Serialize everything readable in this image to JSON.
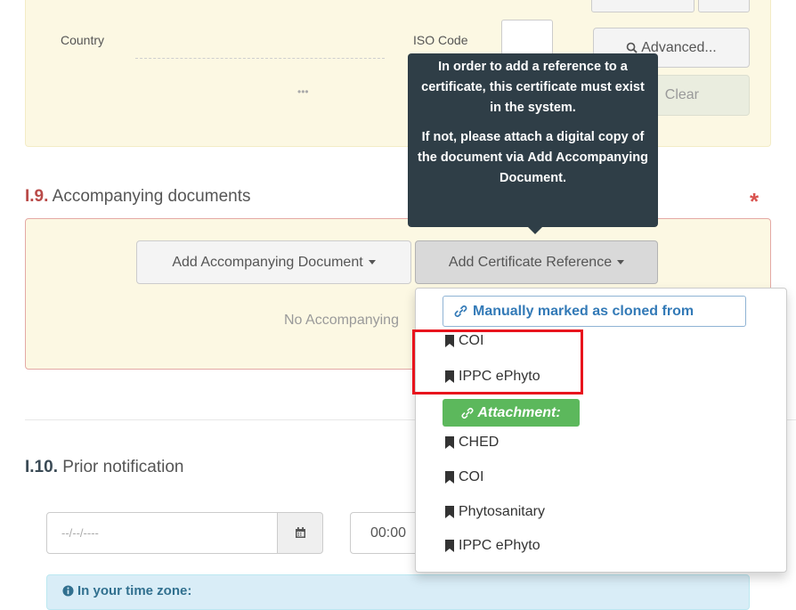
{
  "top_panel": {
    "country_label": "Country",
    "country_value": "•••",
    "iso_label": "ISO Code",
    "advanced_button": "Advanced...",
    "clear_button": "Clear"
  },
  "tooltip": {
    "paragraph1": "In order to add a reference to a certificate, this certificate must exist in the system.",
    "paragraph2_prefix": "If not, please attach a digital copy of the document via ",
    "paragraph2_bold": "Add Accompanying Document",
    "paragraph2_suffix": "."
  },
  "accompanying": {
    "number": "I.9.",
    "title": "Accompanying documents",
    "required_mark": "*",
    "add_document_button": "Add Accompanying Document",
    "add_certificate_button": "Add Certificate Reference",
    "empty_text": "No Accompanying"
  },
  "dropdown": {
    "cloned_label": "Manually marked as cloned from",
    "cloned_items": [
      "COI",
      "IPPC ePhyto"
    ],
    "attachment_label": "Attachment:",
    "attachment_items": [
      "CHED",
      "COI",
      "Phytosanitary",
      "IPPC ePhyto"
    ]
  },
  "prior_notification": {
    "number": "I.10.",
    "title": "Prior notification",
    "date_placeholder": "--/--/----",
    "time_value": "00:00",
    "timezone_label": "In your time zone:"
  },
  "colors": {
    "panel_yellow": "#fcf8e3",
    "error_red": "#b94a48",
    "tooltip_bg": "#2f3e47",
    "link_blue": "#337ab7",
    "success_green": "#5cb85c",
    "highlight_red": "#e8141d"
  },
  "icons": {
    "search": "search-icon",
    "bookmark": "bookmark-icon",
    "link": "link-icon",
    "calendar": "calendar-icon",
    "info": "info-icon"
  }
}
